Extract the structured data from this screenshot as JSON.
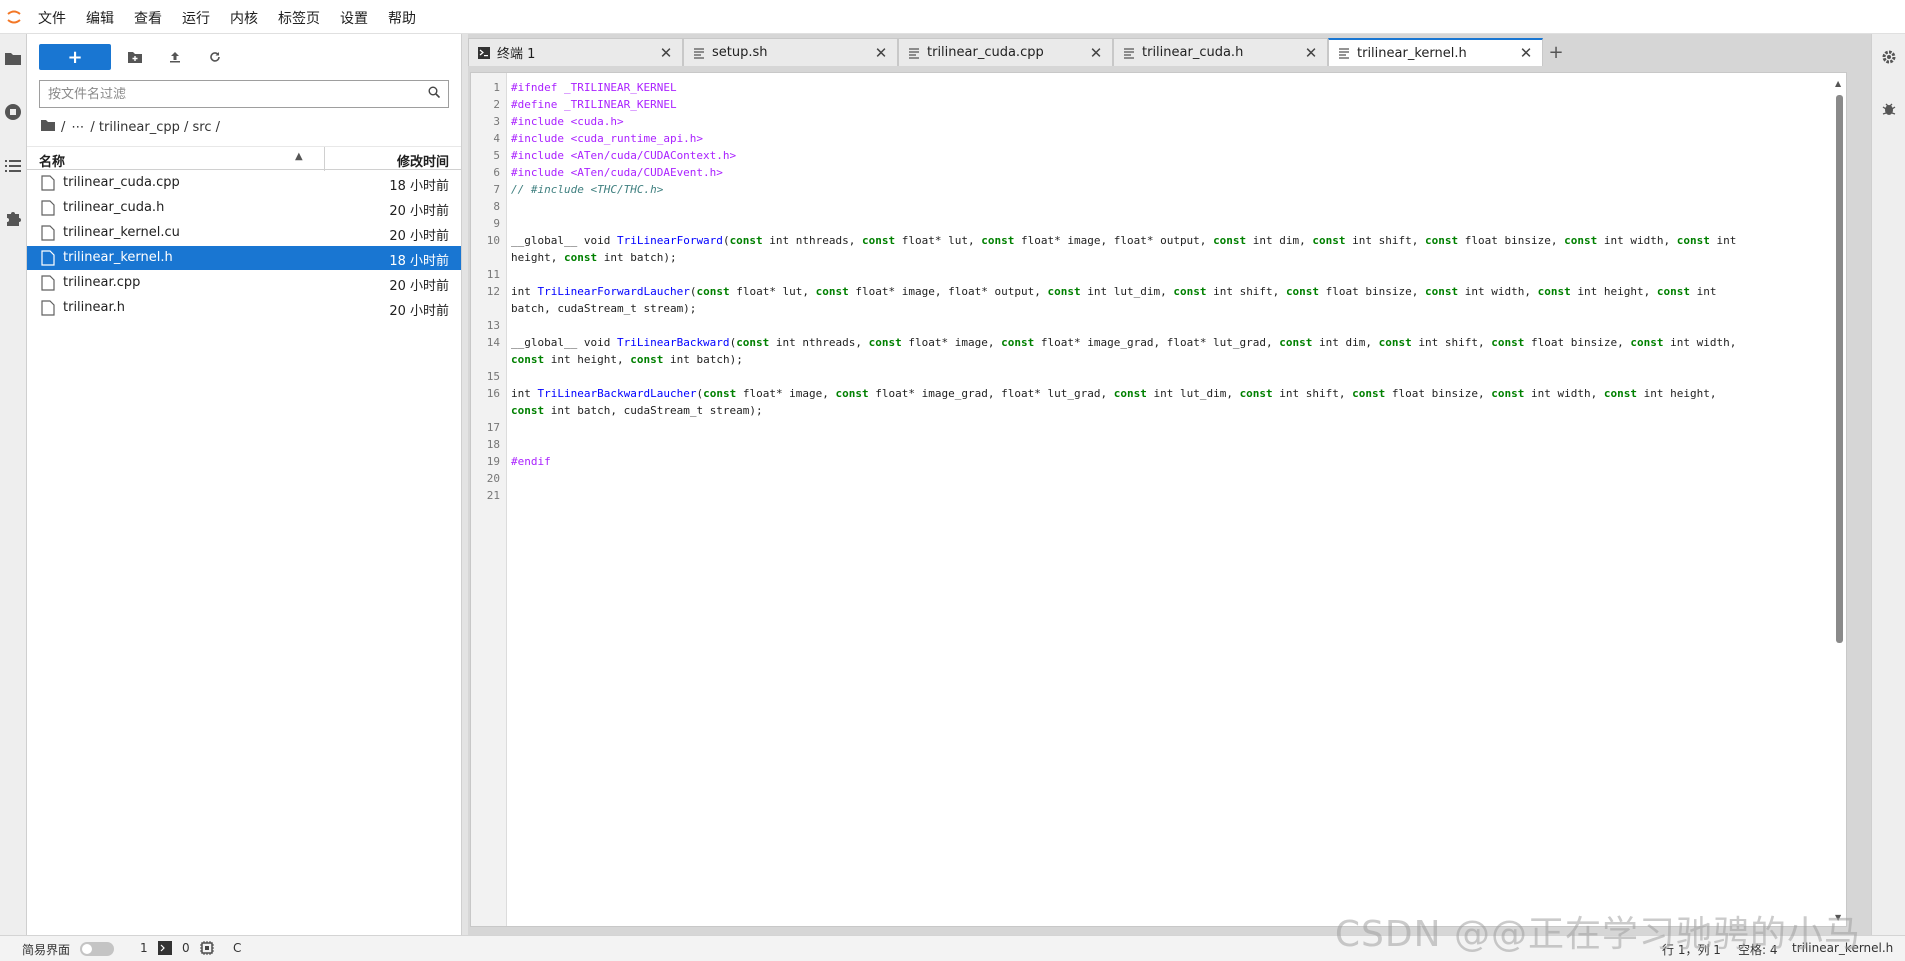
{
  "menubar": {
    "items": [
      "文件",
      "编辑",
      "查看",
      "运行",
      "内核",
      "标签页",
      "设置",
      "帮助"
    ]
  },
  "filebrowser": {
    "new_label": "+",
    "filter_placeholder": "按文件名过滤",
    "breadcrumb": [
      "/",
      "⋯",
      "/ trilinear_cpp / src /"
    ],
    "header_name": "名称",
    "header_modified": "修改时间",
    "files": [
      {
        "name": "trilinear_cuda.cpp",
        "modified": "18 小时前",
        "selected": false
      },
      {
        "name": "trilinear_cuda.h",
        "modified": "20 小时前",
        "selected": false
      },
      {
        "name": "trilinear_kernel.cu",
        "modified": "20 小时前",
        "selected": false
      },
      {
        "name": "trilinear_kernel.h",
        "modified": "18 小时前",
        "selected": true
      },
      {
        "name": "trilinear.cpp",
        "modified": "20 小时前",
        "selected": false
      },
      {
        "name": "trilinear.h",
        "modified": "20 小时前",
        "selected": false
      }
    ]
  },
  "tabs": [
    {
      "label": "终端 1",
      "icon": "terminal-icon",
      "active": false
    },
    {
      "label": "setup.sh",
      "icon": "text-file-icon",
      "active": false
    },
    {
      "label": "trilinear_cuda.cpp",
      "icon": "text-file-icon",
      "active": false
    },
    {
      "label": "trilinear_cuda.h",
      "icon": "text-file-icon",
      "active": false
    },
    {
      "label": "trilinear_kernel.h",
      "icon": "text-file-icon",
      "active": true
    }
  ],
  "code": {
    "line_numbers": [
      "1",
      "2",
      "3",
      "4",
      "5",
      "6",
      "7",
      "8",
      "9",
      "10",
      "",
      "11",
      "12",
      "",
      "13",
      "14",
      "",
      "15",
      "16",
      "",
      "17",
      "18",
      "19",
      "20",
      "21"
    ],
    "lines": [
      "#ifndef _TRILINEAR_KERNEL",
      "#define _TRILINEAR_KERNEL",
      "#include <cuda.h>",
      "#include <cuda_runtime_api.h>",
      "#include <ATen/cuda/CUDAContext.h>",
      "#include <ATen/cuda/CUDAEvent.h>",
      "// #include <THC/THC.h>",
      "",
      "",
      "__global__ void TriLinearForward(const int nthreads, const float* lut, const float* image, float* output, const int dim, const int shift, const float binsize, const int width, const int",
      "height, const int batch);",
      "",
      "int TriLinearForwardLaucher(const float* lut, const float* image, float* output, const int lut_dim, const int shift, const float binsize, const int width, const int height, const int",
      "batch, cudaStream_t stream);",
      "",
      "__global__ void TriLinearBackward(const int nthreads, const float* image, const float* image_grad, float* lut_grad, const int dim, const int shift, const float binsize, const int width,",
      "const int height, const int batch);",
      "",
      "int TriLinearBackwardLaucher(const float* image, const float* image_grad, float* lut_grad, const int lut_dim, const int shift, const float binsize, const int width, const int height,",
      "const int batch, cudaStream_t stream);",
      "",
      "",
      "#endif",
      "",
      ""
    ]
  },
  "statusbar": {
    "simple_mode": "简易界面",
    "count_a": "1",
    "count_b": "0",
    "kernel_letter": "C",
    "cursor": "行 1，列 1",
    "spaces": "空格: 4",
    "filename": "trilinear_kernel.h"
  },
  "watermark": "CSDN @@正在学习驰骋的小马"
}
